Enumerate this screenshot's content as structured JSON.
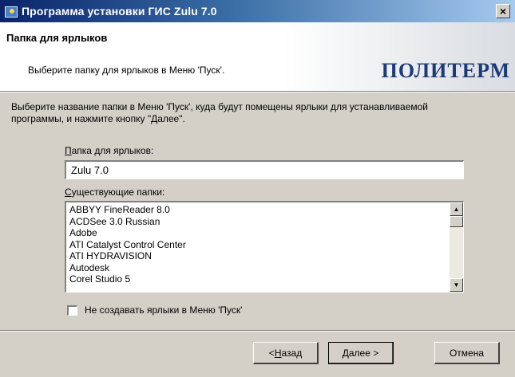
{
  "window": {
    "title": "Программа установки ГИС Zulu 7.0",
    "close_label": "×"
  },
  "header": {
    "title": "Папка для ярлыков",
    "subtitle": "Выберите папку для ярлыков в Меню 'Пуск'.",
    "brand": "ПОЛИТЕРМ"
  },
  "instruction": "Выберите название папки в Меню 'Пуск', куда будут помещены ярлыки для устанавливаемой программы, и нажмите кнопку \"Далее\".",
  "folder_field": {
    "label_mnemonic": "П",
    "label_rest": "апка для ярлыков:",
    "value": "Zulu 7.0"
  },
  "existing_folders": {
    "label_mnemonic": "С",
    "label_rest": "уществующие папки:",
    "items": [
      "ABBYY FineReader 8.0",
      "ACDSee 3.0 Russian",
      "Adobe",
      "ATI Catalyst Control Center",
      "ATI HYDRAVISION",
      "Autodesk",
      "Corel Studio 5"
    ]
  },
  "checkbox": {
    "label": "Не создавать ярлыки в Меню 'Пуск'",
    "checked": false
  },
  "buttons": {
    "back_prefix": "< ",
    "back_mnemonic": "Н",
    "back_rest": "азад",
    "next_mnemonic": "Д",
    "next_rest": "алее >",
    "cancel": "Отмена"
  }
}
